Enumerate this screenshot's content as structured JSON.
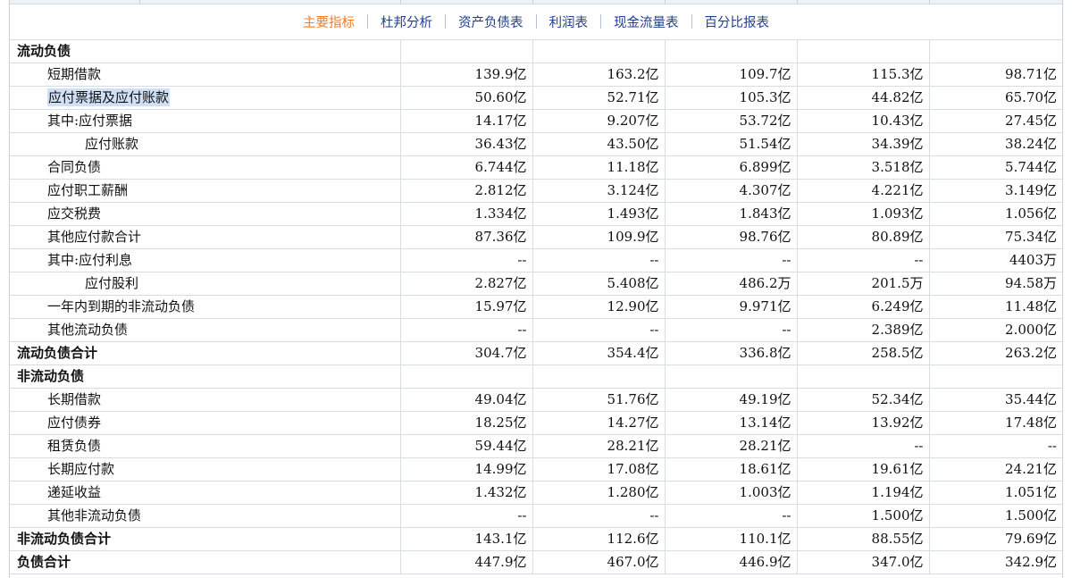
{
  "tabs": [
    {
      "label": "主要指标",
      "active": true
    },
    {
      "label": "杜邦分析",
      "active": false
    },
    {
      "label": "资产负债表",
      "active": false
    },
    {
      "label": "利润表",
      "active": false
    },
    {
      "label": "现金流量表",
      "active": false
    },
    {
      "label": "百分比报表",
      "active": false
    }
  ],
  "rows": [
    {
      "label": "流动负债",
      "level": 0,
      "section": true,
      "values": [
        "",
        "",
        "",
        "",
        ""
      ]
    },
    {
      "label": "短期借款",
      "level": 1,
      "values": [
        "139.9亿",
        "163.2亿",
        "109.7亿",
        "115.3亿",
        "98.71亿"
      ]
    },
    {
      "label": "应付票据及应付账款",
      "level": 1,
      "highlight": true,
      "values": [
        "50.60亿",
        "52.71亿",
        "105.3亿",
        "44.82亿",
        "65.70亿"
      ]
    },
    {
      "label": "其中:应付票据",
      "level": 1,
      "values": [
        "14.17亿",
        "9.207亿",
        "53.72亿",
        "10.43亿",
        "27.45亿"
      ]
    },
    {
      "label": "应付账款",
      "level": 2,
      "values": [
        "36.43亿",
        "43.50亿",
        "51.54亿",
        "34.39亿",
        "38.24亿"
      ]
    },
    {
      "label": "合同负债",
      "level": 1,
      "values": [
        "6.744亿",
        "11.18亿",
        "6.899亿",
        "3.518亿",
        "5.744亿"
      ]
    },
    {
      "label": "应付职工薪酬",
      "level": 1,
      "values": [
        "2.812亿",
        "3.124亿",
        "4.307亿",
        "4.221亿",
        "3.149亿"
      ]
    },
    {
      "label": "应交税费",
      "level": 1,
      "values": [
        "1.334亿",
        "1.493亿",
        "1.843亿",
        "1.093亿",
        "1.056亿"
      ]
    },
    {
      "label": "其他应付款合计",
      "level": 1,
      "values": [
        "87.36亿",
        "109.9亿",
        "98.76亿",
        "80.89亿",
        "75.34亿"
      ]
    },
    {
      "label": "其中:应付利息",
      "level": 1,
      "values": [
        "--",
        "--",
        "--",
        "--",
        "4403万"
      ]
    },
    {
      "label": "应付股利",
      "level": 2,
      "values": [
        "2.827亿",
        "5.408亿",
        "486.2万",
        "201.5万",
        "94.58万"
      ]
    },
    {
      "label": "一年内到期的非流动负债",
      "level": 1,
      "values": [
        "15.97亿",
        "12.90亿",
        "9.971亿",
        "6.249亿",
        "11.48亿"
      ]
    },
    {
      "label": "其他流动负债",
      "level": 1,
      "values": [
        "--",
        "--",
        "--",
        "2.389亿",
        "2.000亿"
      ]
    },
    {
      "label": "流动负债合计",
      "level": 0,
      "section": true,
      "values": [
        "304.7亿",
        "354.4亿",
        "336.8亿",
        "258.5亿",
        "263.2亿"
      ]
    },
    {
      "label": "非流动负债",
      "level": 0,
      "section": true,
      "values": [
        "",
        "",
        "",
        "",
        ""
      ]
    },
    {
      "label": "长期借款",
      "level": 1,
      "values": [
        "49.04亿",
        "51.76亿",
        "49.19亿",
        "52.34亿",
        "35.44亿"
      ]
    },
    {
      "label": "应付债券",
      "level": 1,
      "values": [
        "18.25亿",
        "14.27亿",
        "13.14亿",
        "13.92亿",
        "17.48亿"
      ]
    },
    {
      "label": "租赁负债",
      "level": 1,
      "values": [
        "59.44亿",
        "28.21亿",
        "28.21亿",
        "--",
        "--"
      ]
    },
    {
      "label": "长期应付款",
      "level": 1,
      "values": [
        "14.99亿",
        "17.08亿",
        "18.61亿",
        "19.61亿",
        "24.21亿"
      ]
    },
    {
      "label": "递延收益",
      "level": 1,
      "values": [
        "1.432亿",
        "1.280亿",
        "1.003亿",
        "1.194亿",
        "1.051亿"
      ]
    },
    {
      "label": "其他非流动负债",
      "level": 1,
      "values": [
        "--",
        "--",
        "--",
        "1.500亿",
        "1.500亿"
      ]
    },
    {
      "label": "非流动负债合计",
      "level": 0,
      "section": true,
      "values": [
        "143.1亿",
        "112.6亿",
        "110.1亿",
        "88.55亿",
        "79.69亿"
      ]
    },
    {
      "label": "负债合计",
      "level": 0,
      "section": true,
      "values": [
        "447.9亿",
        "467.0亿",
        "446.9亿",
        "347.0亿",
        "342.9亿"
      ]
    }
  ]
}
